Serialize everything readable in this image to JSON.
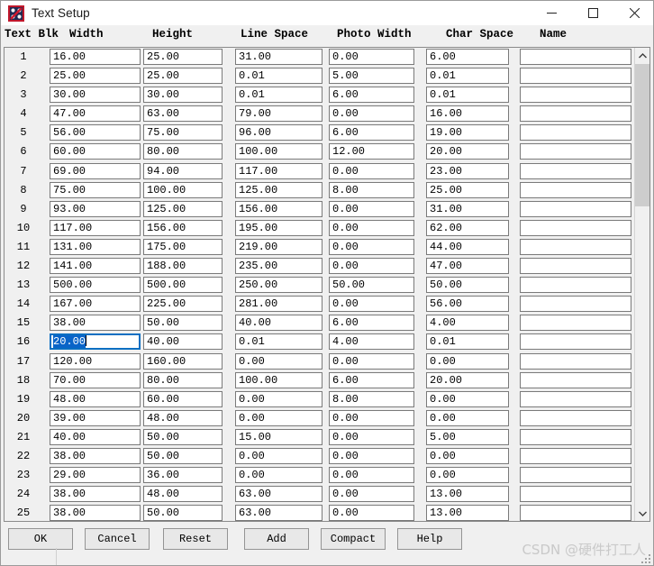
{
  "window": {
    "title": "Text Setup",
    "icon": "domino-dice-icon",
    "minimize_label": "—",
    "maximize_label": "☐",
    "close_label": "✕"
  },
  "table": {
    "columns": [
      "Text Blk",
      "Width",
      "Height",
      "Line Space",
      "Photo Width",
      "Char Space",
      "Name"
    ],
    "selected_cell": {
      "row": 16,
      "column": "Width",
      "value": "20.00",
      "selected_text": "20.00"
    },
    "rows": [
      {
        "num": "1",
        "width": "16.00",
        "height": "25.00",
        "line_space": "31.00",
        "photo_width": "0.00",
        "char_space": "6.00",
        "name": ""
      },
      {
        "num": "2",
        "width": "25.00",
        "height": "25.00",
        "line_space": "0.01",
        "photo_width": "5.00",
        "char_space": "0.01",
        "name": ""
      },
      {
        "num": "3",
        "width": "30.00",
        "height": "30.00",
        "line_space": "0.01",
        "photo_width": "6.00",
        "char_space": "0.01",
        "name": ""
      },
      {
        "num": "4",
        "width": "47.00",
        "height": "63.00",
        "line_space": "79.00",
        "photo_width": "0.00",
        "char_space": "16.00",
        "name": ""
      },
      {
        "num": "5",
        "width": "56.00",
        "height": "75.00",
        "line_space": "96.00",
        "photo_width": "6.00",
        "char_space": "19.00",
        "name": ""
      },
      {
        "num": "6",
        "width": "60.00",
        "height": "80.00",
        "line_space": "100.00",
        "photo_width": "12.00",
        "char_space": "20.00",
        "name": ""
      },
      {
        "num": "7",
        "width": "69.00",
        "height": "94.00",
        "line_space": "117.00",
        "photo_width": "0.00",
        "char_space": "23.00",
        "name": ""
      },
      {
        "num": "8",
        "width": "75.00",
        "height": "100.00",
        "line_space": "125.00",
        "photo_width": "8.00",
        "char_space": "25.00",
        "name": ""
      },
      {
        "num": "9",
        "width": "93.00",
        "height": "125.00",
        "line_space": "156.00",
        "photo_width": "0.00",
        "char_space": "31.00",
        "name": ""
      },
      {
        "num": "10",
        "width": "117.00",
        "height": "156.00",
        "line_space": "195.00",
        "photo_width": "0.00",
        "char_space": "62.00",
        "name": ""
      },
      {
        "num": "11",
        "width": "131.00",
        "height": "175.00",
        "line_space": "219.00",
        "photo_width": "0.00",
        "char_space": "44.00",
        "name": ""
      },
      {
        "num": "12",
        "width": "141.00",
        "height": "188.00",
        "line_space": "235.00",
        "photo_width": "0.00",
        "char_space": "47.00",
        "name": ""
      },
      {
        "num": "13",
        "width": "500.00",
        "height": "500.00",
        "line_space": "250.00",
        "photo_width": "50.00",
        "char_space": "50.00",
        "name": ""
      },
      {
        "num": "14",
        "width": "167.00",
        "height": "225.00",
        "line_space": "281.00",
        "photo_width": "0.00",
        "char_space": "56.00",
        "name": ""
      },
      {
        "num": "15",
        "width": "38.00",
        "height": "50.00",
        "line_space": "40.00",
        "photo_width": "6.00",
        "char_space": "4.00",
        "name": ""
      },
      {
        "num": "16",
        "width": "20.00",
        "height": "40.00",
        "line_space": "0.01",
        "photo_width": "4.00",
        "char_space": "0.01",
        "name": ""
      },
      {
        "num": "17",
        "width": "120.00",
        "height": "160.00",
        "line_space": "0.00",
        "photo_width": "0.00",
        "char_space": "0.00",
        "name": ""
      },
      {
        "num": "18",
        "width": "70.00",
        "height": "80.00",
        "line_space": "100.00",
        "photo_width": "6.00",
        "char_space": "20.00",
        "name": ""
      },
      {
        "num": "19",
        "width": "48.00",
        "height": "60.00",
        "line_space": "0.00",
        "photo_width": "8.00",
        "char_space": "0.00",
        "name": ""
      },
      {
        "num": "20",
        "width": "39.00",
        "height": "48.00",
        "line_space": "0.00",
        "photo_width": "0.00",
        "char_space": "0.00",
        "name": ""
      },
      {
        "num": "21",
        "width": "40.00",
        "height": "50.00",
        "line_space": "15.00",
        "photo_width": "0.00",
        "char_space": "5.00",
        "name": ""
      },
      {
        "num": "22",
        "width": "38.00",
        "height": "50.00",
        "line_space": "0.00",
        "photo_width": "0.00",
        "char_space": "0.00",
        "name": ""
      },
      {
        "num": "23",
        "width": "29.00",
        "height": "36.00",
        "line_space": "0.00",
        "photo_width": "0.00",
        "char_space": "0.00",
        "name": ""
      },
      {
        "num": "24",
        "width": "38.00",
        "height": "48.00",
        "line_space": "63.00",
        "photo_width": "0.00",
        "char_space": "13.00",
        "name": ""
      },
      {
        "num": "25",
        "width": "38.00",
        "height": "50.00",
        "line_space": "63.00",
        "photo_width": "0.00",
        "char_space": "13.00",
        "name": ""
      }
    ]
  },
  "scrollbar": {
    "up_arrow": "▲",
    "down_arrow": "▼"
  },
  "buttons": [
    {
      "label": "OK"
    },
    {
      "label": "Cancel"
    },
    {
      "label": "Reset"
    },
    {
      "label": "Add"
    },
    {
      "label": "Compact"
    },
    {
      "label": "Help"
    }
  ],
  "watermark": "CSDN @硬件打工人",
  "colors": {
    "selection_blue": "#0a64c8",
    "window_bg": "#f0f0f0",
    "cell_bg": "#ffffff",
    "scroll_thumb": "#cdcdcd"
  }
}
